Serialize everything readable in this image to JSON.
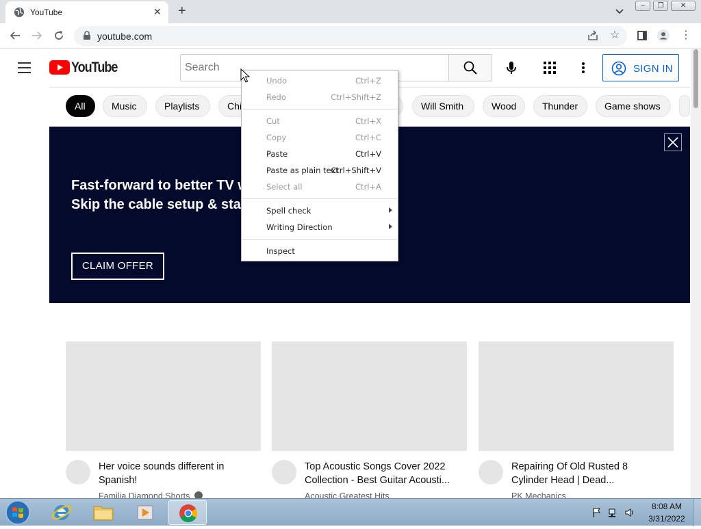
{
  "browser": {
    "tab_title": "YouTube",
    "url": "youtube.com",
    "window_controls": {
      "minimize": "–",
      "restore": "❐",
      "close": "✕"
    }
  },
  "youtube": {
    "logo_text": "YouTube",
    "search_placeholder": "Search",
    "sign_in_label": "SIGN IN",
    "chips": [
      "All",
      "Music",
      "Playlists",
      "Chi",
      "Will Smith",
      "Wood",
      "Thunder",
      "Game shows"
    ],
    "banner": {
      "line1": "Fast-forward to better TV w",
      "line2": "Skip the cable setup & sta",
      "cta": "CLAIM OFFER"
    },
    "videos": [
      {
        "title": "Her voice sounds different in Spanish!",
        "channel": "Familia Diamond Shorts"
      },
      {
        "title": "Top Acoustic Songs Cover 2022 Collection - Best Guitar Acousti...",
        "channel": "Acoustic Greatest Hits"
      },
      {
        "title": "Repairing Of Old Rusted 8 Cylinder Head | Dead...",
        "channel": "PK Mechanics"
      }
    ]
  },
  "context_menu": {
    "items": [
      {
        "label": "Undo",
        "shortcut": "Ctrl+Z"
      },
      {
        "label": "Redo",
        "shortcut": "Ctrl+Shift+Z"
      },
      {
        "label": "Cut",
        "shortcut": "Ctrl+X"
      },
      {
        "label": "Copy",
        "shortcut": "Ctrl+C"
      },
      {
        "label": "Paste",
        "shortcut": "Ctrl+V"
      },
      {
        "label": "Paste as plain text",
        "shortcut": "Ctrl+Shift+V"
      },
      {
        "label": "Select all",
        "shortcut": "Ctrl+A"
      },
      {
        "label": "Spell check",
        "shortcut": ""
      },
      {
        "label": "Writing Direction",
        "shortcut": ""
      },
      {
        "label": "Inspect",
        "shortcut": ""
      }
    ]
  },
  "taskbar": {
    "time": "8:08 AM",
    "date": "3/31/2022"
  },
  "colors": {
    "yt_red": "#ff0000",
    "link_blue": "#065fd4",
    "banner_bg": "#030a2c"
  }
}
